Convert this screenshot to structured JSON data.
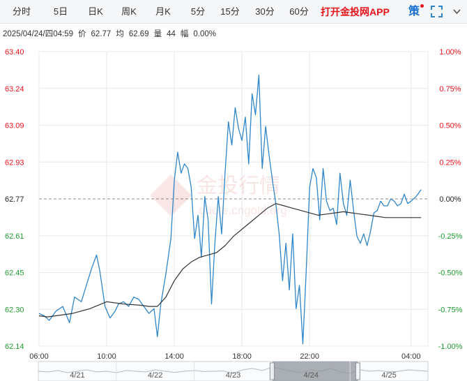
{
  "tabs": [
    {
      "label": "分时",
      "active": true
    },
    {
      "label": "5日",
      "active": false
    },
    {
      "label": "日K",
      "active": false
    },
    {
      "label": "周K",
      "active": false
    },
    {
      "label": "月K",
      "active": false
    },
    {
      "label": "5分",
      "active": false
    },
    {
      "label": "15分",
      "active": false
    },
    {
      "label": "30分",
      "active": false
    },
    {
      "label": "60分",
      "active": false
    }
  ],
  "promo_label": "打开金投网APP",
  "strategy_label": "策",
  "icons": {
    "fullscreen": "fullscreen-icon",
    "more": "chevron-down-icon"
  },
  "info": {
    "datetime": "2025/04/24/四04:59",
    "price_label": "价",
    "price": "62.77",
    "avg_label": "均",
    "avg": "62.69",
    "volume_label": "量",
    "volume": "44",
    "change_label": "幅",
    "change": "0.00%"
  },
  "watermark": {
    "text": "金投行情",
    "subtext": "quote.cngold.org"
  },
  "colors": {
    "price_line": "#2f86c9",
    "avg_line": "#333333",
    "up": "#e8121a",
    "down": "#1f9d2f",
    "grid": "#e6e8ec",
    "ref_line": "#888888"
  },
  "chart_data": {
    "type": "line",
    "reference_price": 62.77,
    "ylim": [
      62.14,
      63.4
    ],
    "y_ticks_left": [
      "63.40",
      "63.24",
      "63.09",
      "62.93",
      "62.77",
      "62.61",
      "62.45",
      "62.30",
      "62.14"
    ],
    "y_ticks_right": [
      "1.00%",
      "0.75%",
      "0.50%",
      "0.25%",
      "0.00%",
      "-0.25%",
      "-0.50%",
      "-0.75%",
      "-1.00%"
    ],
    "x_ticks": [
      "06:00",
      "10:00",
      "14:00",
      "18:00",
      "22:00",
      "04:00"
    ],
    "x_tick_hours": [
      0,
      4,
      8,
      12,
      16,
      22
    ],
    "x_range_hours": [
      0,
      23
    ],
    "series": [
      {
        "name": "价",
        "x": [
          0,
          0.3,
          0.6,
          1,
          1.4,
          1.8,
          2.1,
          2.5,
          2.8,
          3.1,
          3.4,
          3.6,
          3.9,
          4.2,
          4.5,
          4.7,
          5,
          5.3,
          5.6,
          5.9,
          6.2,
          6.5,
          6.8,
          7,
          7.2,
          7.5,
          7.8,
          8,
          8.2,
          8.4,
          8.6,
          8.8,
          9,
          9.2,
          9.4,
          9.6,
          9.8,
          10,
          10.2,
          10.4,
          10.6,
          10.8,
          11,
          11.2,
          11.4,
          11.6,
          11.8,
          12,
          12.2,
          12.4,
          12.6,
          12.8,
          13,
          13.2,
          13.4,
          13.6,
          13.8,
          14,
          14.2,
          14.4,
          14.6,
          14.8,
          15,
          15.2,
          15.4,
          15.6,
          15.8,
          16,
          16.2,
          16.4,
          16.6,
          16.8,
          17,
          17.2,
          17.4,
          17.6,
          17.8,
          18,
          18.2,
          18.4,
          18.6,
          18.8,
          19,
          19.2,
          19.4,
          19.6,
          19.8,
          20,
          20.2,
          20.4,
          20.6,
          20.8,
          21,
          21.2,
          21.4,
          21.6,
          21.8,
          22,
          22.3,
          22.6
        ],
        "values": [
          62.28,
          62.27,
          62.25,
          62.29,
          62.31,
          62.24,
          62.35,
          62.33,
          62.4,
          62.47,
          62.53,
          62.46,
          62.31,
          62.26,
          62.29,
          62.32,
          62.33,
          62.31,
          62.35,
          62.34,
          62.31,
          62.28,
          62.3,
          62.18,
          62.32,
          62.45,
          62.6,
          62.85,
          62.97,
          62.88,
          62.92,
          62.9,
          62.82,
          62.6,
          62.7,
          62.52,
          62.78,
          62.68,
          62.32,
          62.58,
          62.78,
          62.62,
          62.88,
          63.1,
          63.0,
          63.16,
          63.07,
          63.02,
          63.12,
          62.92,
          63.22,
          63.13,
          63.3,
          62.9,
          63.08,
          62.96,
          62.85,
          62.75,
          62.62,
          62.42,
          62.58,
          62.38,
          62.62,
          62.3,
          62.4,
          62.15,
          62.46,
          62.82,
          62.9,
          62.86,
          62.68,
          62.9,
          62.76,
          62.72,
          62.73,
          62.66,
          62.88,
          62.75,
          62.7,
          62.85,
          62.72,
          62.61,
          62.58,
          62.62,
          62.57,
          62.63,
          62.71,
          62.72,
          62.76,
          62.74,
          62.74,
          62.77,
          62.76,
          62.74,
          62.75,
          62.79,
          62.75,
          62.76,
          62.78,
          62.81
        ]
      },
      {
        "name": "均",
        "x": [
          0,
          0.5,
          1,
          2,
          3,
          4,
          5,
          6,
          6.5,
          7,
          7.5,
          8,
          8.5,
          9,
          9.5,
          10,
          10.5,
          11,
          11.5,
          12,
          12.5,
          13,
          13.5,
          14,
          14.5,
          15,
          15.5,
          16,
          16.5,
          17,
          17.5,
          18,
          18.5,
          19,
          19.5,
          20,
          20.5,
          21,
          21.5,
          22,
          22.6
        ],
        "values": [
          62.27,
          62.265,
          62.27,
          62.28,
          62.3,
          62.33,
          62.32,
          62.315,
          62.31,
          62.31,
          62.35,
          62.42,
          62.47,
          62.5,
          62.52,
          62.53,
          62.54,
          62.57,
          62.61,
          62.64,
          62.67,
          62.7,
          62.73,
          62.75,
          62.74,
          62.73,
          62.72,
          62.71,
          62.7,
          62.705,
          62.71,
          62.715,
          62.71,
          62.705,
          62.7,
          62.695,
          62.69,
          62.69,
          62.69,
          62.69,
          62.69
        ]
      }
    ]
  },
  "navigator": {
    "dates": [
      "4/21",
      "4/22",
      "4/23",
      "4/24",
      "4/25"
    ],
    "values": [
      0.5,
      0.45,
      0.55,
      0.4,
      0.5,
      0.6,
      0.45,
      0.5,
      0.4,
      0.55,
      0.5,
      0.45,
      0.6,
      0.5,
      0.42,
      0.5,
      0.55,
      0.48,
      0.5,
      0.52,
      0.35,
      0.6,
      0.7,
      0.55,
      0.8,
      0.65,
      0.5,
      0.4,
      0.6,
      0.5,
      0.7,
      0.45,
      0.35,
      0.6,
      0.5,
      0.55,
      0.45,
      0.5,
      0.6,
      0.55,
      0.5
    ],
    "selected_range": [
      0.6,
      0.82
    ]
  }
}
